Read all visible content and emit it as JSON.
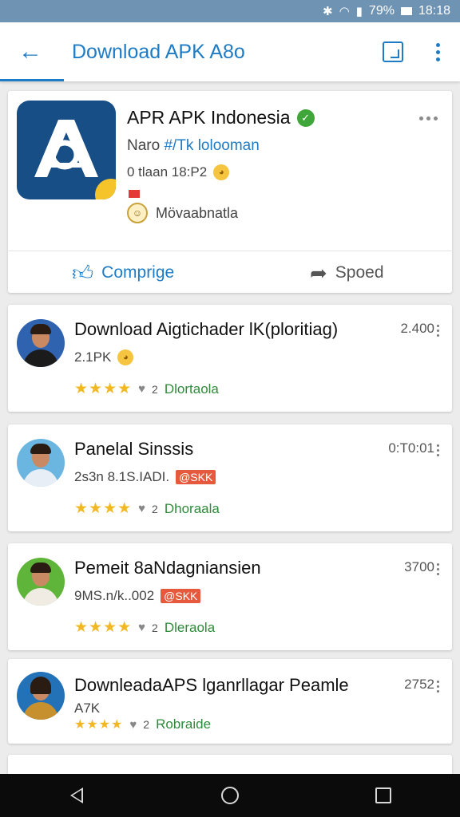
{
  "status_bar": {
    "bluetooth_icon": "bluetooth-icon",
    "battery": "79%",
    "time": "18:18"
  },
  "app_bar": {
    "title": "Download APK A8o",
    "back_icon": "arrow-left-icon",
    "open_icon": "open-external-icon",
    "menu_icon": "more-vertical-icon"
  },
  "hero": {
    "title": "APR APK Indonesia",
    "developer_prefix": "Naro",
    "developer_link": "#/Tk lolooman",
    "meta": "0 tlaan 18:P2",
    "category": "Mövaabnatla",
    "compare_label": "Comprige",
    "share_label": "Spoed"
  },
  "items": [
    {
      "title": "Download Aigtichader lK(ploritiag)",
      "sub": "2.1PK",
      "tag": "",
      "count": "2.400",
      "reviews": "2",
      "category": "Dlortaola",
      "avatar_color": "#2f63b0"
    },
    {
      "title": "Panelal Sinssis",
      "sub": "2s3n 8.1S.IADI.",
      "tag": "@SKK",
      "count": "0:T0:01",
      "reviews": "2",
      "category": "Dhoraala",
      "avatar_color": "#6bb6e0"
    },
    {
      "title": "Pemeit 8aNdagniansien",
      "sub": "9MS.n/k..002",
      "tag": "@SKK",
      "count": "3700",
      "reviews": "2",
      "category": "Dleraola",
      "avatar_color": "#5fb53a"
    },
    {
      "title": "DownleadaAPS lganrllagar Peamle",
      "sub": "A7K",
      "tag": "",
      "count": "2752",
      "reviews": "2",
      "category": "Robraide",
      "avatar_color": "#2372b8"
    }
  ],
  "rating_stars": "★★★★"
}
